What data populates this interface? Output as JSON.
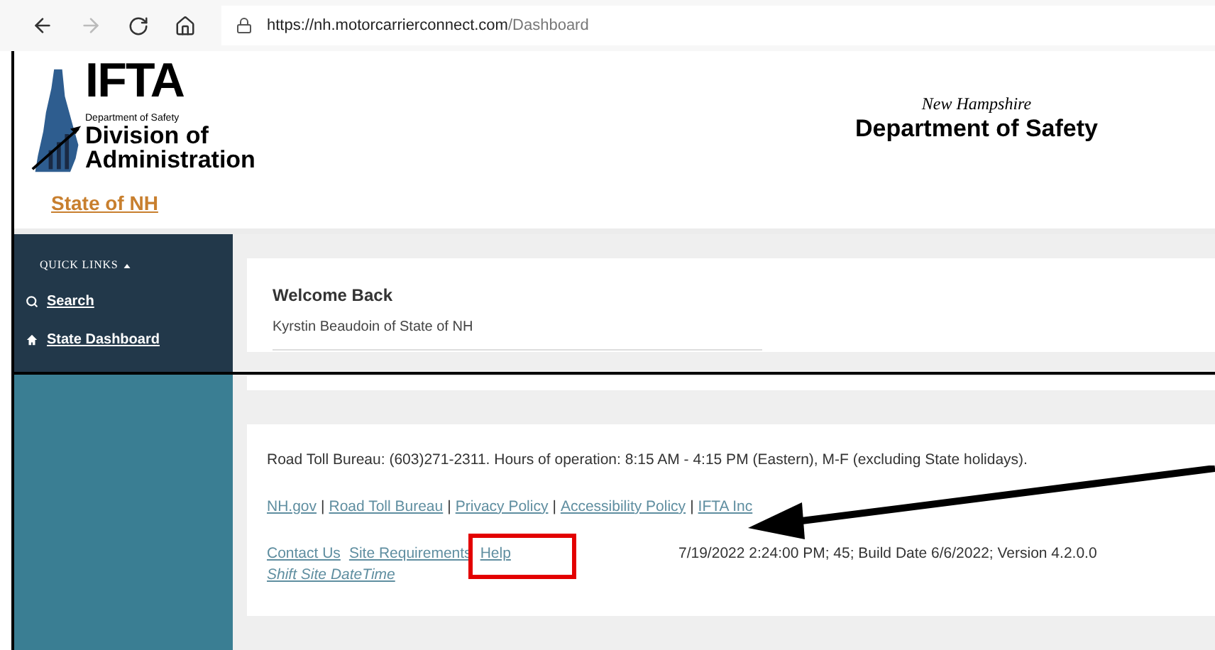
{
  "browser": {
    "url_base": "https://nh.motorcarrierconnect.com",
    "url_path": "/Dashboard"
  },
  "header": {
    "logo": {
      "title": "IFTA",
      "line_1": "Department of Safety",
      "line_2": "Division of",
      "line_3": "Administration"
    },
    "state_link": "State of NH",
    "agency": {
      "line_1": "New Hampshire",
      "line_2": "Department of Safety"
    }
  },
  "sidebar": {
    "heading": "QUICK LINKS",
    "expanded": true,
    "items": [
      {
        "label": "Search",
        "kind": "search"
      },
      {
        "label": "State Dashboard",
        "kind": "home"
      }
    ]
  },
  "welcome": {
    "title": "Welcome Back",
    "subtitle": "Kyrstin Beaudoin of State of NH"
  },
  "footer": {
    "contact": "Road Toll Bureau: (603)271-2311. Hours of operation: 8:15 AM - 4:15 PM (Eastern), M-F (excluding State holidays).",
    "link_separator": "|",
    "links": [
      "NH.gov",
      "Road Toll Bureau",
      "Privacy Policy",
      "Accessibility Policy",
      "IFTA Inc"
    ],
    "bottom_links": [
      "Contact Us",
      "Site Requirements",
      "Help"
    ],
    "build_info": "7/19/2022 2:24:00 PM; 45; Build Date 6/6/2022; Version 4.2.0.0",
    "shift_link": "Shift Site DateTime"
  }
}
